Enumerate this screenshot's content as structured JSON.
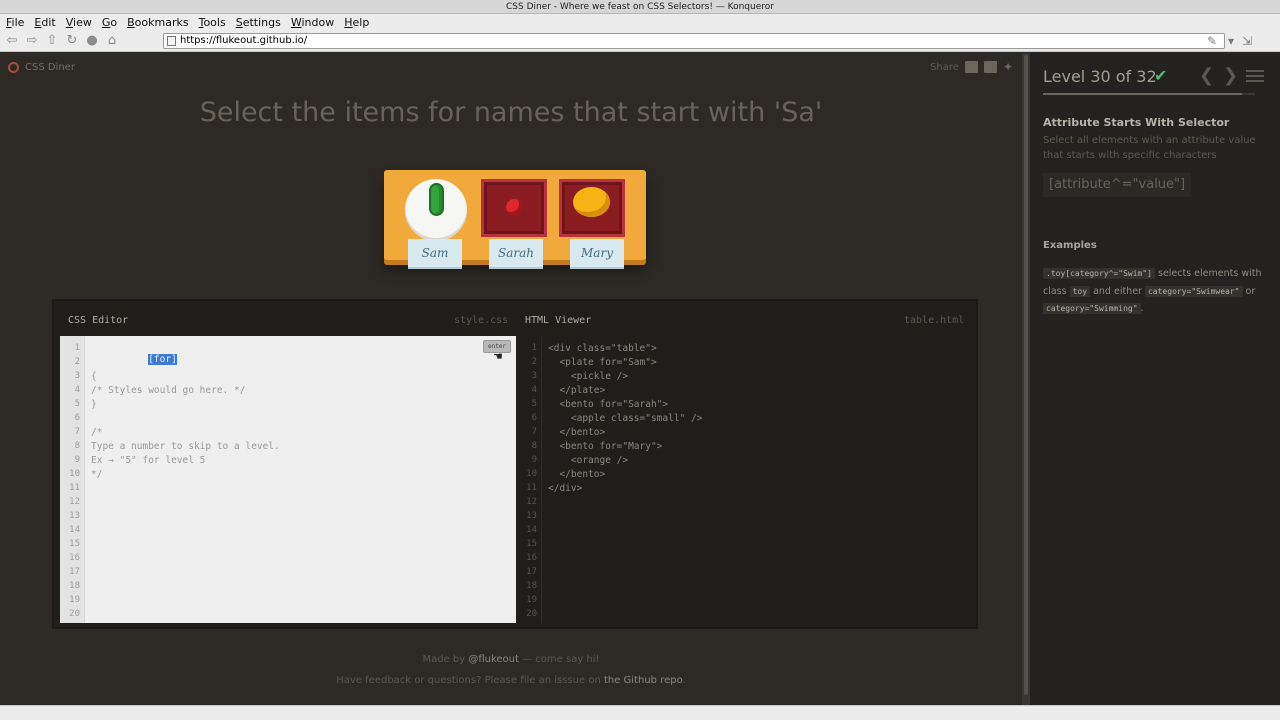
{
  "window": {
    "title": "CSS Diner - Where we feast on CSS Selectors! — Konqueror",
    "menu": [
      "File",
      "Edit",
      "View",
      "Go",
      "Bookmarks",
      "Tools",
      "Settings",
      "Window",
      "Help"
    ],
    "url": "https://flukeout.github.io/"
  },
  "header": {
    "logo_text": "CSS Diner",
    "share_label": "Share"
  },
  "order": "Select the items for names that start with 'Sa'",
  "table": {
    "tags": [
      "Sam",
      "Sarah",
      "Mary"
    ]
  },
  "editor": {
    "css_title": "CSS Editor",
    "css_file": "style.css",
    "html_title": "HTML Viewer",
    "html_file": "table.html",
    "enter_label": "enter",
    "selector_input": "[for]",
    "css_lines": [
      "",
      "{",
      "/* Styles would go here. */",
      "}",
      "",
      "/*",
      "Type a number to skip to a level.",
      "Ex → \"5\" for level 5",
      "*/"
    ],
    "html_lines": [
      "<div class=\"table\">",
      "  <plate for=\"Sam\">",
      "    <pickle />",
      "  </plate>",
      "  <bento for=\"Sarah\">",
      "    <apple class=\"small\" />",
      "  </bento>",
      "  <bento for=\"Mary\">",
      "    <orange />",
      "  </bento>",
      "</div>"
    ],
    "line_numbers": [
      "1",
      "2",
      "3",
      "4",
      "5",
      "6",
      "7",
      "8",
      "9",
      "10",
      "11",
      "12",
      "13",
      "14",
      "15",
      "16",
      "17",
      "18",
      "19",
      "20"
    ]
  },
  "footer": {
    "made_by_prefix": "Made by ",
    "made_by_handle": "@flukeout",
    "made_by_suffix": " — come say hi!",
    "feedback_prefix": "Have feedback or questions? Please file an isssue on ",
    "feedback_link": "the Github repo",
    "feedback_suffix": "."
  },
  "sidebar": {
    "level_label": "Level 30 of 32",
    "progress": 0.9375,
    "selector_name": "Attribute Starts With Selector",
    "selector_desc": "Select all elements with an attribute value that starts with specific characters",
    "syntax": "[attribute^=\"value\"]",
    "examples_title": "Examples",
    "ex_code1": ".toy[category^=\"Swim\"]",
    "ex_text1": " selects elements with class ",
    "ex_code2": "toy",
    "ex_text2": " and either ",
    "ex_code3": "category=\"Swimwear\"",
    "ex_text3": " or ",
    "ex_code4": "category=\"Swimming\"",
    "ex_text4": "."
  },
  "colors": {
    "accent_green": "#4cbb6c",
    "table_orange": "#f2a93b",
    "bento_red": "#8a1d22"
  }
}
